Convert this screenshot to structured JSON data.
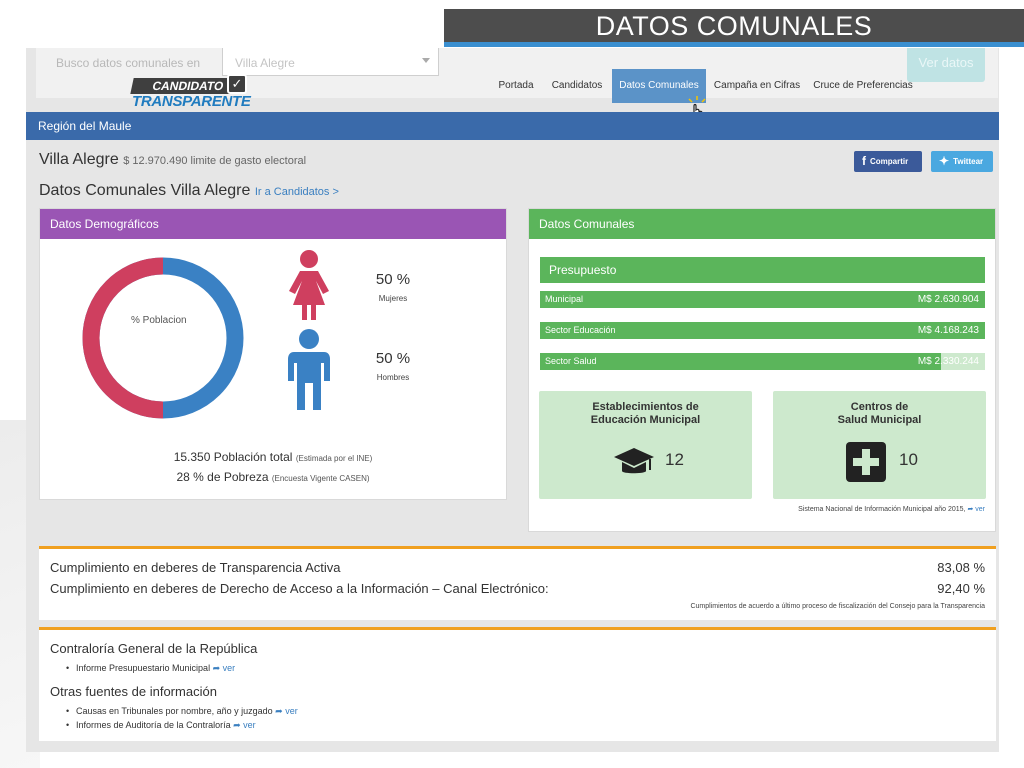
{
  "slide": {
    "title": "DATOS COMUNALES"
  },
  "topbar": {
    "search_label": "Busco datos comunales  en",
    "commune_select": "Villa Alegre",
    "ver_datos": "Ver datos"
  },
  "logo": {
    "line1": "CANDIDATO",
    "line2": "TRANSPARENTE"
  },
  "nav": {
    "items": [
      {
        "label": "Portada",
        "active": false
      },
      {
        "label": "Candidatos",
        "active": false
      },
      {
        "label": "Datos Comunales",
        "active": true
      },
      {
        "label": "Campaña en Cifras",
        "active": false
      },
      {
        "label": "Cruce de Preferencias",
        "active": false
      }
    ]
  },
  "region": {
    "label": "Región del Maule"
  },
  "commune": {
    "name": "Villa Alegre",
    "spending_limit": "$ 12.970.490 limite de gasto electoral",
    "title": "Datos Comunales Villa Alegre",
    "candidates_link": "Ir a Candidatos >"
  },
  "share": {
    "facebook": "Compartir",
    "twitter": "Twittear"
  },
  "demographics": {
    "header": "Datos Demográficos",
    "donut_label": "% Poblacion",
    "women_pct": "50 %",
    "women_label": "Mujeres",
    "men_pct": "50 %",
    "men_label": "Hombres",
    "women_share": 0.5,
    "population": "15.350 Población total",
    "population_note": "(Estimada por el INE)",
    "poverty": "28 % de Pobreza",
    "poverty_note": "(Encuesta Vigente CASEN)",
    "colors": {
      "women": "#cf3f5f",
      "men": "#3a81c4"
    }
  },
  "communal": {
    "header": "Datos Comunales",
    "budget_header": "Presupuesto",
    "budget": [
      {
        "label": "Municipal",
        "value": "M$ 2.630.904",
        "fill": 1.0
      },
      {
        "label": "Sector Educación",
        "value": "M$ 4.168.243",
        "fill": 1.0
      },
      {
        "label": "Sector Salud",
        "value": "M$ 2.330.244",
        "fill": 0.9
      }
    ],
    "tiles": [
      {
        "title1": "Establecimientos de",
        "title2": "Educación Municipal",
        "value": "12",
        "icon": "graduation-cap-icon"
      },
      {
        "title1": "Centros de",
        "title2": "Salud Municipal",
        "value": "10",
        "icon": "medical-cross-icon"
      }
    ],
    "source": "Sistema Nacional de Información Municipal año 2015,",
    "source_link": "ver",
    "colors": {
      "header": "#5bb55b",
      "tile": "#cde9cd"
    }
  },
  "transparency": {
    "rows": [
      {
        "label": "Cumplimiento en deberes de Transparencia Activa",
        "value": "83,08 %"
      },
      {
        "label": "Cumplimiento en deberes de Derecho de Acceso a la Información – Canal Electrónico:",
        "value": "92,40 %"
      }
    ],
    "note": "Cumplimientos de acuerdo a último proceso de fiscalización del Consejo para la Transparencia"
  },
  "sources": {
    "contraloria_title": "Contraloría General de la República",
    "contraloria_items": [
      {
        "label": "Informe Presupuestario Municipal",
        "link": "ver"
      }
    ],
    "other_title": "Otras fuentes de información",
    "other_items": [
      {
        "label": "Causas en Tribunales por nombre, año y juzgado",
        "link": "ver"
      },
      {
        "label": "Informes de Auditoría de la Contraloría",
        "link": "ver"
      }
    ]
  }
}
